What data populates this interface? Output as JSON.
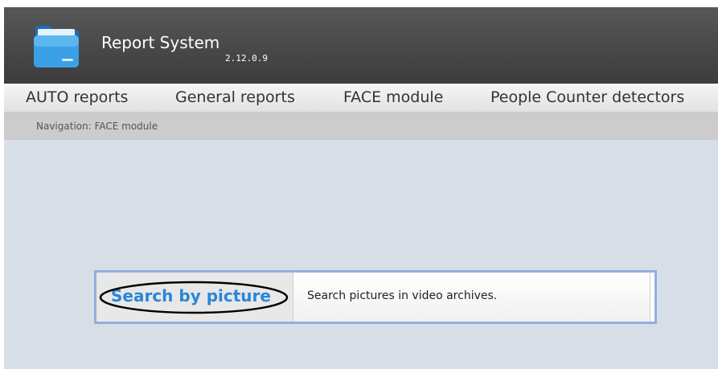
{
  "header": {
    "title": "Report System",
    "version": "2.12.0.9",
    "logo_icon": "folder-icon"
  },
  "nav": {
    "items": [
      {
        "label": "AUTO reports"
      },
      {
        "label": "General reports"
      },
      {
        "label": "FACE module"
      },
      {
        "label": "People Counter detectors"
      }
    ]
  },
  "breadcrumb": {
    "text": "Navigation: FACE module"
  },
  "module": {
    "link_label": "Search by picture",
    "description": "Search pictures in video archives."
  },
  "colors": {
    "header_bg": "#4a4a4a",
    "content_bg": "#d8dee8",
    "link": "#2a86d8",
    "card_border": "#8fb0dd"
  }
}
